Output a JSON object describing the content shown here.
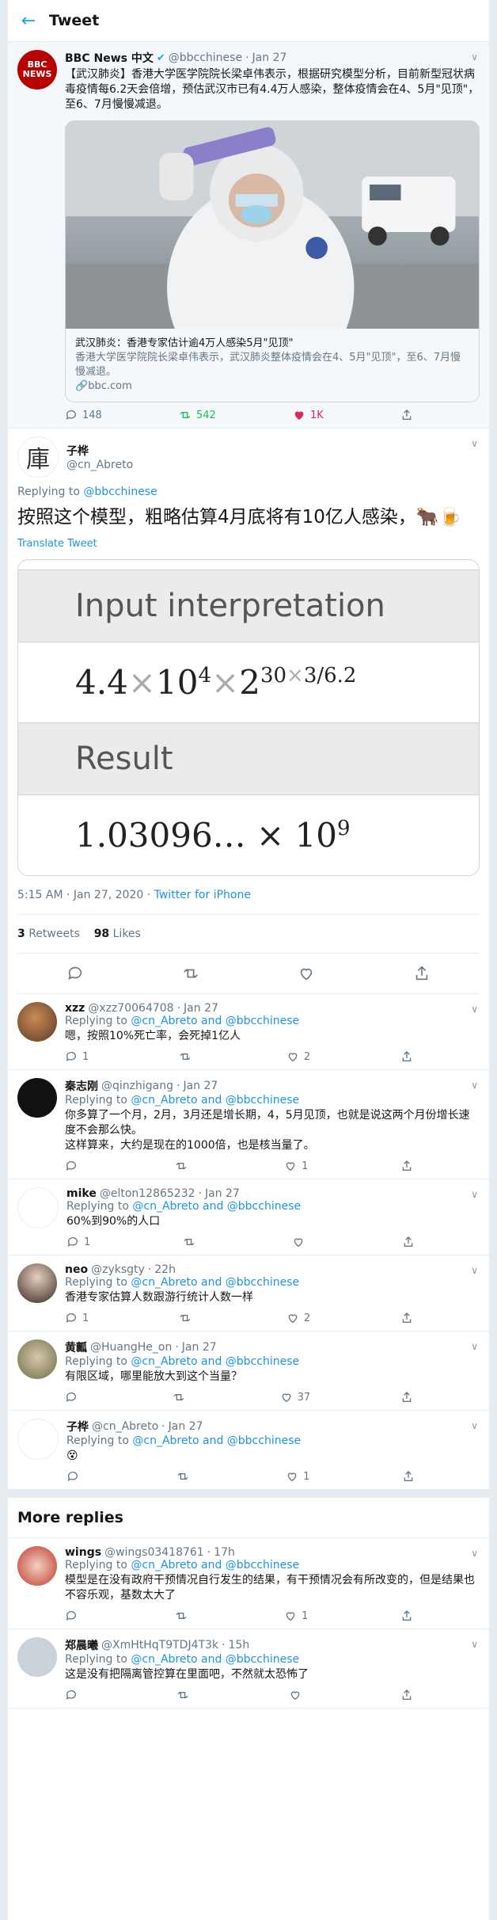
{
  "header": {
    "title": "Tweet"
  },
  "context_tweet": {
    "name": "BBC News 中文",
    "handle": "@bbcchinese",
    "time": "Jan 27",
    "text": "【武汉肺炎】香港大学医学院院长梁卓伟表示，根据研究模型分析，目前新型冠状病毒疫情每6.2天会倍增，预估武汉市已有4.4万人感染，整体疫情会在4、5月\"见顶\"，至6、7月慢慢减退。",
    "avatar_text": "BBC\nNEWS",
    "card": {
      "title": "武汉肺炎：香港专家估计逾4万人感染5月\"见顶\"",
      "description": "香港大学医学院院长梁卓伟表示，武汉肺炎整体疫情会在4、5月\"见顶\"，至6、7月慢慢减退。",
      "url": "bbc.com"
    },
    "replies": "148",
    "retweets": "542",
    "likes": "1K"
  },
  "focused_tweet": {
    "name": "子桦",
    "handle": "@cn_Abreto",
    "replying_prefix": "Replying to",
    "replying_to": "@bbcchinese",
    "text": "按照这个模型，粗略估算4月底将有10亿人感染，🐂🍺",
    "translate": "Translate Tweet",
    "math": {
      "heading1": "Input interpretation",
      "expr_base": "4.4",
      "expr_times": "×",
      "expr_ten": "10",
      "expr_exp4": "4",
      "expr_two": "2",
      "expr_exp": "30",
      "expr_exp_rest": "3/6.2",
      "heading2": "Result",
      "result": "1.03096… × 10",
      "result_exp": "9"
    },
    "time": "5:15 AM · Jan 27, 2020 · ",
    "source": "Twitter for iPhone",
    "retweets_count": "3",
    "retweets_label": "Retweets",
    "likes_count": "98",
    "likes_label": "Likes"
  },
  "replies": [
    {
      "name": "xzz",
      "handle": "@xzz70064708",
      "time": "Jan 27",
      "prefix": "Replying to",
      "to": "@cn_Abreto and @bbcchinese",
      "text": "嗯，按照10%死亡率，会死掉1亿人",
      "replies": "1",
      "retweets": "",
      "likes": "2"
    },
    {
      "name": "秦志刚",
      "handle": "@qinzhigang",
      "time": "Jan 27",
      "prefix": "Replying to",
      "to": "@cn_Abreto and @bbcchinese",
      "text": "你多算了一个月，2月，3月还是增长期，4，5月见顶，也就是说这两个月份增长速度不会那么快。\n这样算来，大约是现在的1000倍，也是核当量了。",
      "replies": "",
      "retweets": "",
      "likes": "1"
    },
    {
      "name": "mike",
      "handle": "@elton12865232",
      "time": "Jan 27",
      "prefix": "Replying to",
      "to": "@cn_Abreto and @bbcchinese",
      "text": "60%到90%的人口",
      "replies": "1",
      "retweets": "",
      "likes": ""
    },
    {
      "name": "neo",
      "handle": "@zyksgty",
      "time": "22h",
      "prefix": "Replying to",
      "to": "@cn_Abreto and @bbcchinese",
      "text": "香港专家估算人数跟游行统计人数一样",
      "replies": "1",
      "retweets": "",
      "likes": "2"
    },
    {
      "name": "黄瓤",
      "handle": "@HuangHe_on",
      "time": "Jan 27",
      "prefix": "Replying to",
      "to": "@cn_Abreto and @bbcchinese",
      "text": "有限区域，哪里能放大到这个当量？",
      "replies": "",
      "retweets": "",
      "likes": "37"
    },
    {
      "name": "子桦",
      "handle": "@cn_Abreto",
      "time": "Jan 27",
      "prefix": "Replying to",
      "to": "@cn_Abreto and @bbcchinese",
      "text": "😵",
      "replies": "",
      "retweets": "",
      "likes": "1"
    }
  ],
  "more_replies_title": "More replies",
  "more_replies": [
    {
      "name": "wings",
      "handle": "@wings03418761",
      "time": "17h",
      "prefix": "Replying to",
      "to": "@cn_Abreto and @bbcchinese",
      "text": "模型是在没有政府干预情况自行发生的结果，有干预情况会有所改变的，但是结果也不容乐观，基数太大了",
      "replies": "",
      "retweets": "",
      "likes": "1"
    },
    {
      "name": "郑晨曦",
      "handle": "@XmHtHqT9TDJ4T3k",
      "time": "15h",
      "prefix": "Replying to",
      "to": "@cn_Abreto and @bbcchinese",
      "text": "这是没有把隔离管控算在里面吧，不然就太恐怖了",
      "replies": "",
      "retweets": "",
      "likes": ""
    }
  ],
  "colors": {
    "accent": "#1da1f2",
    "retweet": "#17bf63",
    "like": "#e0245e"
  },
  "icons": [
    "back-arrow-icon",
    "chevron-down-icon",
    "verified-icon",
    "reply-icon",
    "retweet-icon",
    "like-icon",
    "share-icon",
    "link-icon"
  ]
}
